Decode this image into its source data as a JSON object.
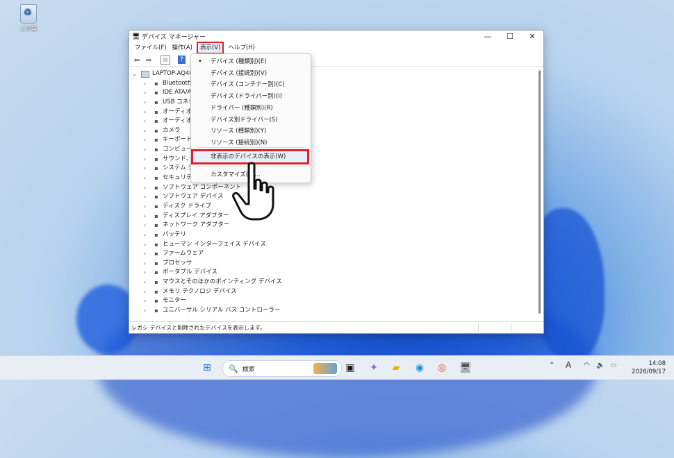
{
  "desktop": {
    "recycle_bin_label": "ごみ箱"
  },
  "window": {
    "title": "デバイス マネージャー",
    "controls": {
      "minimize": "—",
      "maximize": "☐",
      "close": "✕"
    },
    "menu": [
      "ファイル(F)",
      "操作(A)",
      "表示(V)",
      "ヘルプ(H)"
    ],
    "toolbar_icons": [
      "back-icon",
      "forward-icon",
      "properties-icon",
      "help-icon"
    ],
    "root_node": "LAPTOP-AQ40",
    "devices": [
      "Bluetooth",
      "IDE ATA/A",
      "USB コネク",
      "オーディオの",
      "オーディオ処",
      "カメラ",
      "キーボード",
      "コンピューター",
      "サウンド、ビ",
      "システム デ",
      "セキュリティ",
      "ソフトウェア コンポーネント",
      "ソフトウェア デバイス",
      "ディスク ドライブ",
      "ディスプレイ アダプター",
      "ネットワーク アダプター",
      "バッテリ",
      "ヒューマン インターフェイス デバイス",
      "ファームウェア",
      "プロセッサ",
      "ポータブル デバイス",
      "マウスとそのほかのポインティング デバイス",
      "メモリ テクノロジ デバイス",
      "モニター",
      "ユニバーサル シリアル バス コントローラー"
    ],
    "status_text": "レガシ デバイスと削除されたデバイスを表示します。"
  },
  "view_menu": {
    "items": [
      {
        "label": "デバイス (種類別)(E)",
        "checked": true
      },
      {
        "label": "デバイス (接続別)(V)",
        "checked": false
      },
      {
        "label": "デバイス (コンテナー別)(C)",
        "checked": false
      },
      {
        "label": "デバイス (ドライバー別)(I)",
        "checked": false
      },
      {
        "label": "ドライバー (種類別)(R)",
        "checked": false
      },
      {
        "label": "デバイス別ドライバー(S)",
        "checked": false
      },
      {
        "label": "リソース (種類別)(Y)",
        "checked": false
      },
      {
        "label": "リソース (接続別)(N)",
        "checked": false
      }
    ],
    "show_hidden": "非表示のデバイスの表示(W)",
    "customize": "カスタマイズ(U)...",
    "bullet": "•"
  },
  "taskbar": {
    "search_placeholder": "検索",
    "time": "14:08",
    "date": "2026/09/17",
    "ime": "A"
  },
  "colors": {
    "highlight": "#e0202a",
    "accent": "#3d6fd1"
  }
}
